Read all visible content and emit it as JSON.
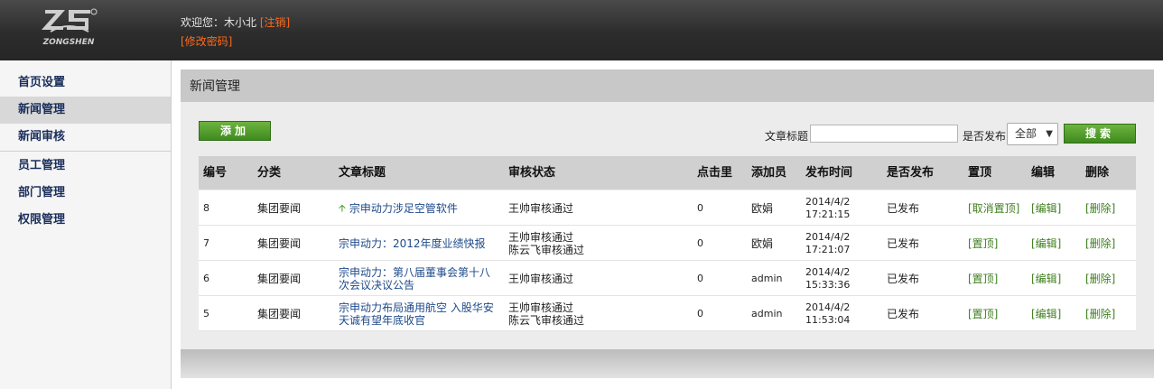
{
  "header": {
    "welcome_prefix": "欢迎您：木小北",
    "logout_label": "[注销]",
    "change_password_label": "[修改密码]",
    "logo_text": "ZONGSHEN"
  },
  "sidebar": {
    "items": [
      {
        "label": "首页设置"
      },
      {
        "label": "新闻管理"
      },
      {
        "label": "新闻审核"
      },
      {
        "label": "员工管理"
      },
      {
        "label": "部门管理"
      },
      {
        "label": "权限管理"
      }
    ],
    "active_index": 1
  },
  "panel": {
    "title": "新闻管理",
    "add_label": "添加",
    "search_title_label": "文章标题",
    "search_title_value": "",
    "published_label": "是否发布",
    "published_selected": "全部",
    "search_label": "搜索"
  },
  "table": {
    "columns": [
      "编号",
      "分类",
      "文章标题",
      "审核状态",
      "点击里",
      "添加员",
      "发布时间",
      "是否发布",
      "置顶",
      "编辑",
      "删除"
    ],
    "rows": [
      {
        "id": "8",
        "category": "集团要闻",
        "title_line1": "宗申动力涉足空管软件",
        "title_line2": "",
        "pinned": true,
        "status_line1": "王帅审核通过",
        "status_line2": "",
        "clicks": "0",
        "author": "欧娟",
        "date": "2014/4/2",
        "time": "17:21:15",
        "published": "已发布",
        "pin_action": "[取消置顶]",
        "edit_action": "[编辑]",
        "delete_action": "[删除]"
      },
      {
        "id": "7",
        "category": "集团要闻",
        "title_line1": "宗申动力：2012年度业绩快报",
        "title_line2": "",
        "pinned": false,
        "status_line1": "王帅审核通过",
        "status_line2": "陈云飞审核通过",
        "clicks": "0",
        "author": "欧娟",
        "date": "2014/4/2",
        "time": "17:21:07",
        "published": "已发布",
        "pin_action": "[置顶]",
        "edit_action": "[编辑]",
        "delete_action": "[删除]"
      },
      {
        "id": "6",
        "category": "集团要闻",
        "title_line1": "宗申动力：第八届董事会第十八",
        "title_line2": "次会议决议公告",
        "pinned": false,
        "status_line1": "王帅审核通过",
        "status_line2": "",
        "clicks": "0",
        "author": "admin",
        "date": "2014/4/2",
        "time": "15:33:36",
        "published": "已发布",
        "pin_action": "[置顶]",
        "edit_action": "[编辑]",
        "delete_action": "[删除]"
      },
      {
        "id": "5",
        "category": "集团要闻",
        "title_line1": "宗申动力布局通用航空 入股华安",
        "title_line2": "天诚有望年底收官",
        "pinned": false,
        "status_line1": "王帅审核通过",
        "status_line2": "陈云飞审核通过",
        "clicks": "0",
        "author": "admin",
        "date": "2014/4/2",
        "time": "11:53:04",
        "published": "已发布",
        "pin_action": "[置顶]",
        "edit_action": "[编辑]",
        "delete_action": "[删除]"
      }
    ]
  },
  "colors": {
    "accent_orange": "#ff6a1a",
    "button_green": "#4f9a2a",
    "link_blue": "#1e4a8a",
    "action_green": "#3f7f1f"
  }
}
